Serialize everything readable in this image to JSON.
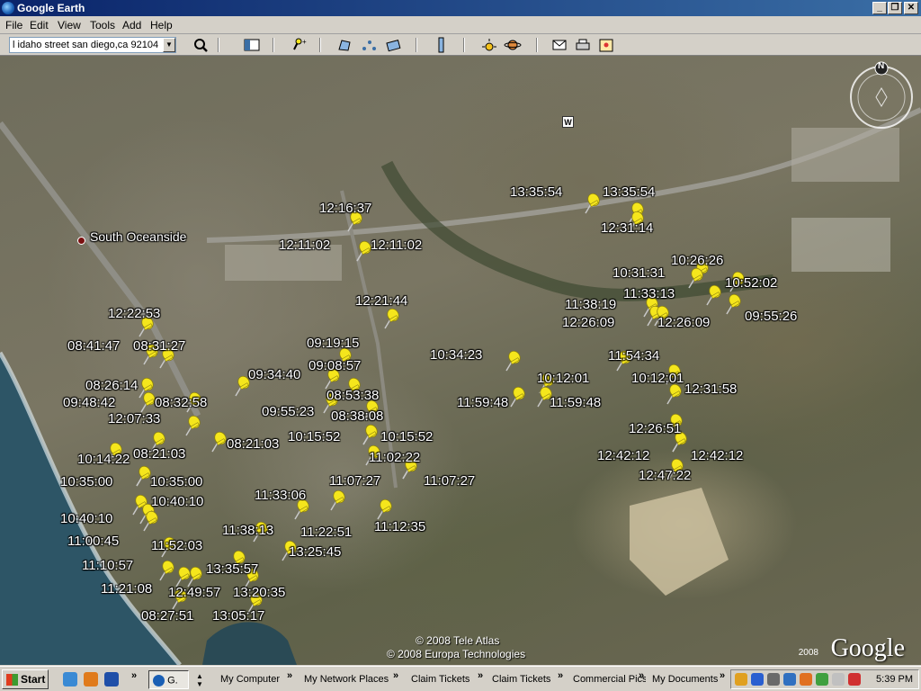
{
  "window": {
    "title": "Google Earth"
  },
  "menu": [
    "File",
    "Edit",
    "View",
    "Tools",
    "Add",
    "Help"
  ],
  "search": {
    "value": "l idaho street san diego,ca 92104"
  },
  "map": {
    "place_label": "South Oceanside",
    "road_sign": "W",
    "compass": "N",
    "copyright_1": "© 2008 Tele Atlas",
    "copyright_2": "© 2008 Europa Technologies",
    "logo": "Google",
    "logo_year": "2008",
    "pins": [
      {
        "label": "13:35:54"
      },
      {
        "label": "13:35:54"
      },
      {
        "label": "12:31:14"
      },
      {
        "label": "12:16:37"
      },
      {
        "label": "12:11:02"
      },
      {
        "label": "12:11:02"
      },
      {
        "label": "10:26:26"
      },
      {
        "label": "10:31:31"
      },
      {
        "label": "10:52:02"
      },
      {
        "label": "11:33:13"
      },
      {
        "label": "11:38:19"
      },
      {
        "label": "12:26:09"
      },
      {
        "label": "12:26:09"
      },
      {
        "label": "09:55:26"
      },
      {
        "label": "12:21:44"
      },
      {
        "label": "12:22:53"
      },
      {
        "label": "08:41:47"
      },
      {
        "label": "08:31:27"
      },
      {
        "label": "09:19:15"
      },
      {
        "label": "09:08:57"
      },
      {
        "label": "09:34:40"
      },
      {
        "label": "10:34:23"
      },
      {
        "label": "11:54:34"
      },
      {
        "label": "10:12:01"
      },
      {
        "label": "10:12:01"
      },
      {
        "label": "08:26:14"
      },
      {
        "label": "08:53:38"
      },
      {
        "label": "12:31:58"
      },
      {
        "label": "09:48:42"
      },
      {
        "label": "08:32:58"
      },
      {
        "label": "11:59:48"
      },
      {
        "label": "11:59:48"
      },
      {
        "label": "09:55:23"
      },
      {
        "label": "08:38:08"
      },
      {
        "label": "12:07:33"
      },
      {
        "label": "12:26:51"
      },
      {
        "label": "10:15:52"
      },
      {
        "label": "10:15:52"
      },
      {
        "label": "08:21:03"
      },
      {
        "label": "08:21:03"
      },
      {
        "label": "12:42:12"
      },
      {
        "label": "12:42:12"
      },
      {
        "label": "10:14:22"
      },
      {
        "label": "11:02:22"
      },
      {
        "label": "10:35:00"
      },
      {
        "label": "10:35:00"
      },
      {
        "label": "11:07:27"
      },
      {
        "label": "11:07:27"
      },
      {
        "label": "12:47:22"
      },
      {
        "label": "10:40:10"
      },
      {
        "label": "11:33:06"
      },
      {
        "label": "10:40:10"
      },
      {
        "label": "11:12:35"
      },
      {
        "label": "11:38:13"
      },
      {
        "label": "11:22:51"
      },
      {
        "label": "11:00:45"
      },
      {
        "label": "11:52:03"
      },
      {
        "label": "13:25:45"
      },
      {
        "label": "11:10:57"
      },
      {
        "label": "13:35:57"
      },
      {
        "label": "11:21:08"
      },
      {
        "label": "12:49:57"
      },
      {
        "label": "13:20:35"
      },
      {
        "label": "08:27:51"
      },
      {
        "label": "13:05:17"
      }
    ]
  },
  "taskbar": {
    "start": "Start",
    "ge_item": "G.",
    "items": [
      "My Computer",
      "My Network Places",
      "Claim Tickets",
      "Claim Tickets",
      "Commercial Pics",
      "My Documents"
    ],
    "chevron": "»",
    "clock": "5:39 PM"
  },
  "colors": {
    "pin": "#f5e61c",
    "titlebar": "#0a246a",
    "ocean": "#2d5566"
  }
}
